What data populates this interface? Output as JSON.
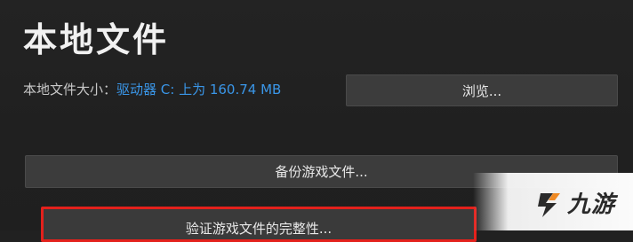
{
  "header": {
    "title": "本地文件"
  },
  "local_files": {
    "size_label": "本地文件大小：",
    "size_value": "驱动器 C: 上为 160.74 MB",
    "browse_label": "浏览...",
    "backup_label": "备份游戏文件...",
    "verify_label": "验证游戏文件的完整性..."
  },
  "highlight": {
    "border_color": "#e3211c"
  },
  "watermark": {
    "text": "九游",
    "icon": "jiuyou-logo-icon"
  }
}
